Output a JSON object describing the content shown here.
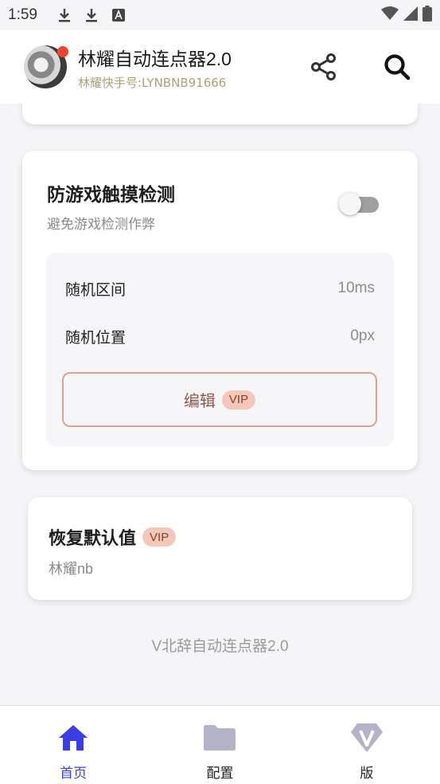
{
  "status_bar": {
    "time": "1:59",
    "left_icons": [
      "download-icon",
      "download-icon",
      "font-icon"
    ],
    "right_icons": [
      "wifi-icon",
      "signal-icon",
      "battery-icon"
    ]
  },
  "header": {
    "title": "林耀自动连点器2.0",
    "subtitle": "林耀快手号:LYNBNB91666",
    "actions": [
      "share-icon",
      "search-icon"
    ]
  },
  "anti_detect": {
    "title": "防游戏触摸检测",
    "description": "避免游戏检测作弊",
    "toggle_on": false,
    "random_interval_label": "随机区间",
    "random_interval_value": "10ms",
    "random_position_label": "随机位置",
    "random_position_value": "0px",
    "edit_label": "编辑",
    "vip_label": "VIP"
  },
  "reset": {
    "title": "恢复默认值",
    "vip_label": "VIP",
    "description": "林耀nb"
  },
  "footer_text": "V北辞自动连点器2.0",
  "bottom_nav": {
    "items": [
      {
        "label": "首页",
        "icon": "home-icon",
        "active": true
      },
      {
        "label": "配置",
        "icon": "folder-icon",
        "active": false
      },
      {
        "label": "版",
        "icon": "diamond-v-icon",
        "active": false
      }
    ]
  },
  "colors": {
    "accent": "#3b3ee6",
    "vip_bg": "#f3c8b8",
    "vip_text": "#8a3f27",
    "subtitle_gold": "#a8a36f",
    "nav_inactive_icon": "#b4b2c6"
  }
}
